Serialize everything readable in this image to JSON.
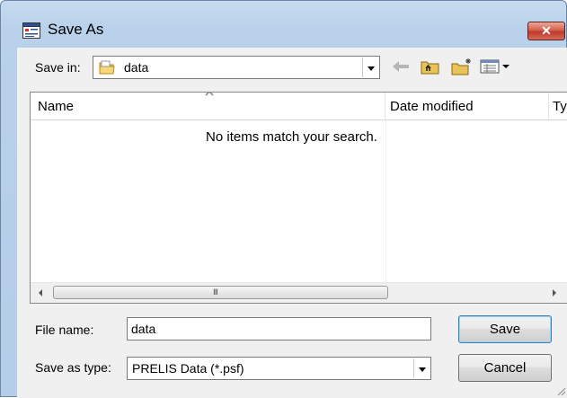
{
  "window": {
    "title": "Save As",
    "close_glyph": "✕",
    "title_icon": "app-document-icon"
  },
  "toolbar": {
    "save_in_label": "Save in:",
    "save_in_value": "data",
    "icons": [
      "back-arrow-icon",
      "up-folder-icon",
      "new-folder-icon",
      "views-menu-icon"
    ]
  },
  "file_list": {
    "columns": [
      "Name",
      "Date modified",
      "Ty"
    ],
    "empty_message": "No items match your search.",
    "scroll_grip": "III"
  },
  "form": {
    "file_name_label": "File name:",
    "file_name_value": "data",
    "save_type_label": "Save as type:",
    "save_type_value": "PRELIS Data (*.psf)"
  },
  "buttons": {
    "save": "Save",
    "cancel": "Cancel"
  },
  "colors": {
    "close_button": "#c0392b",
    "frame": "#b9d1ea",
    "client": "#f0f0f0"
  }
}
